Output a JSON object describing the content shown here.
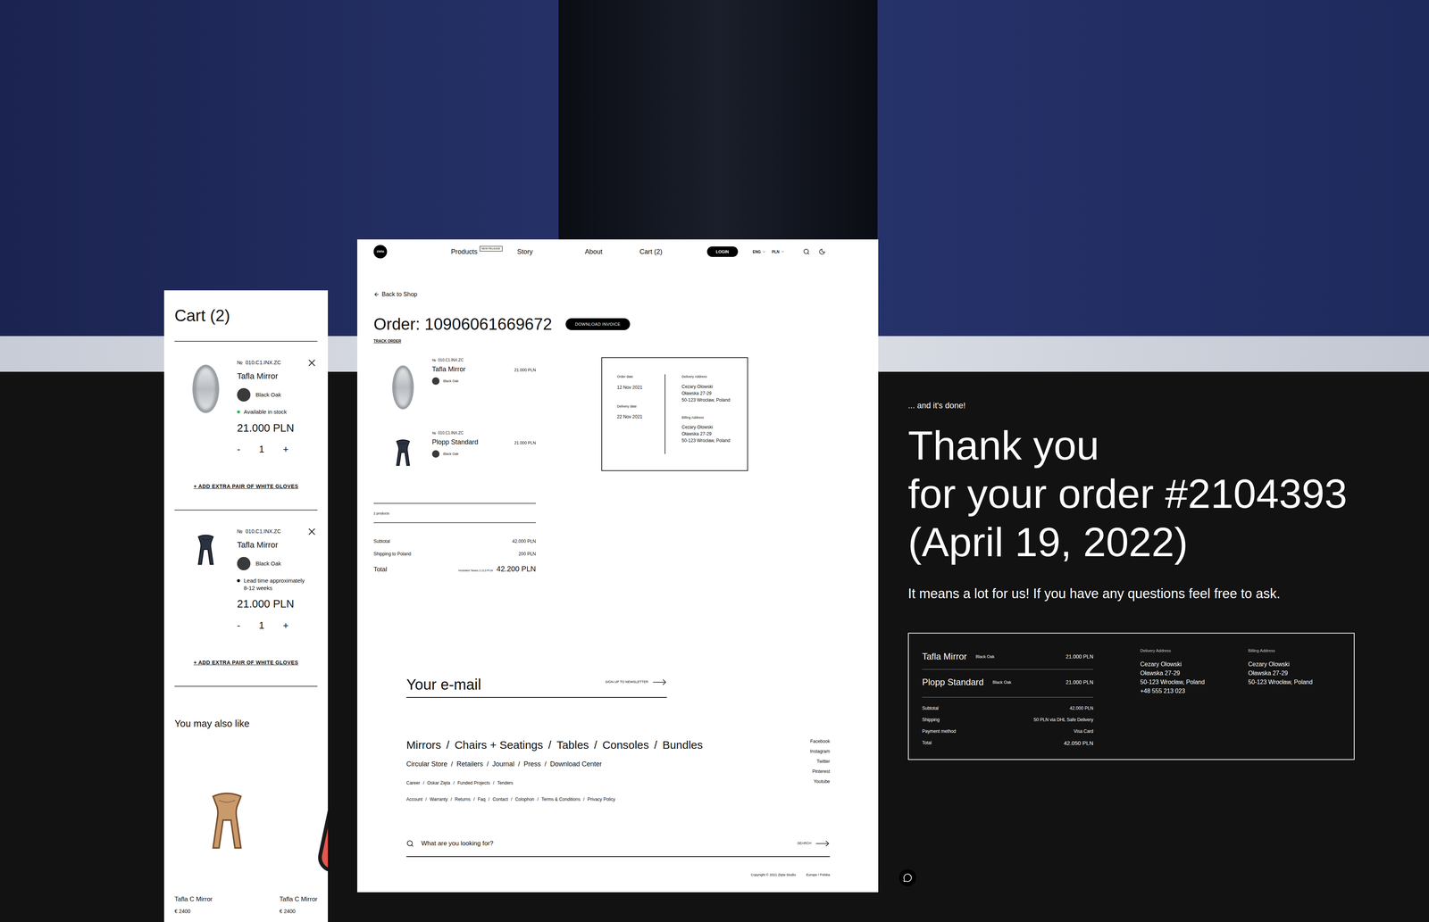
{
  "cart": {
    "title": "Cart (2)",
    "items": [
      {
        "kind": "mirror",
        "number_mark": "№",
        "sku": "010.C1.INX.ZC",
        "name": "Tafla Mirror",
        "finish": "Black Oak",
        "availability": "Available in stock",
        "color": "#2fb45a",
        "price": "21.000 PLN",
        "minus": "-",
        "quantity": "1",
        "plus": "+",
        "gloves": "+ ADD EXTRA PAIR OF WHITE GLOVES"
      },
      {
        "kind": "stool",
        "number_mark": "№",
        "sku": "010.C1.INX.ZC",
        "name": "Tafla Mirror",
        "finish": "Black Oak",
        "availability": "Lead time approximately 8-12 weeks",
        "color": "#111111",
        "price": "21.000 PLN",
        "minus": "-",
        "quantity": "1",
        "plus": "+",
        "gloves": "+ ADD EXTRA PAIR OF WHITE GLOVES"
      }
    ],
    "recommendations": {
      "title": "You may also like",
      "products": [
        {
          "kind": "stool",
          "name": "Tafla C Mirror",
          "price": "€ 2400"
        },
        {
          "kind": "mirror",
          "name": "Tafla C Mirror",
          "price": "€ 2400"
        }
      ]
    }
  },
  "page": {
    "nav": {
      "logo": "zieta",
      "items": [
        {
          "label": "Products",
          "badge": "NEW RELEASE"
        },
        {
          "label": "Story",
          "badge": ""
        },
        {
          "label": "About",
          "badge": ""
        },
        {
          "label": "Cart (2)",
          "badge": ""
        }
      ],
      "login": "LOGIN",
      "language": "ENG",
      "currency": "PLN"
    },
    "back": "Back to Shop",
    "order_title": "Order: 10906061669672",
    "download": "DOWNLOAD INVOICE",
    "track": "TRACK ORDER",
    "items": [
      {
        "kind": "mirror",
        "number_mark": "№",
        "sku": "010.C1.INX.ZC",
        "name": "Tafla Mirror",
        "finish": "Black Oak",
        "price": "21.000 PLN"
      },
      {
        "kind": "stool",
        "number_mark": "№",
        "sku": "010.C1.INX.ZC",
        "name": "Plopp Standard",
        "finish": "Black Oak",
        "price": "21.000 PLN"
      }
    ],
    "count": "2 products",
    "summary": [
      {
        "label": "Subtotal",
        "value": "42.000 PLN"
      },
      {
        "label": "Shipping to Poland",
        "value": "200 PLN"
      }
    ],
    "total": {
      "label": "Total",
      "note": "Included Taxes 2.113 PLN",
      "value": "42.200 PLN"
    },
    "details": {
      "dates": [
        {
          "label": "Order date",
          "value": "12 Nov 2021"
        },
        {
          "label": "Delivery date",
          "value": "22 Nov 2021"
        }
      ],
      "addresses": [
        {
          "label": "Delivery Address",
          "lines": [
            "Cezary Olowski",
            "Oławska 27-29",
            "50-123 Wrocław, Poland"
          ]
        },
        {
          "label": "Billing Address",
          "lines": [
            "Cezary Olowski",
            "Oławska 27-29",
            "50-123 Wrocław, Poland"
          ]
        }
      ]
    },
    "footer": {
      "email": "Your e-mail",
      "signup": "SIGN UP TO NEWSLETTER",
      "separator": "/",
      "categories": [
        "Mirrors",
        "Chairs + Seatings",
        "Tables",
        "Consoles",
        "Bundles"
      ],
      "secondary": [
        "Circular Store",
        "Retailers",
        "Journal",
        "Press",
        "Download Center"
      ],
      "tertiary": [
        "Career",
        "Oskar Zięta",
        "Funded Projects",
        "Tenders"
      ],
      "links": [
        "Account",
        "Warranty",
        "Returns",
        "Faq",
        "Contact",
        "Colophon",
        "Terms & Conditions",
        "Privacy Policy"
      ],
      "socials": [
        "Facebook",
        "Instagram",
        "Twitter",
        "Pinterest",
        "Youtube"
      ],
      "search_placeholder": "What are you looking for?",
      "search_button": "SEARCH",
      "copyright": "Copyright © 2021 Zięta Studio",
      "region": "Europe / Polska"
    }
  },
  "thanks": {
    "kicker": "... and it's done!",
    "heading": [
      "Thank you",
      "for your order #2104393",
      "(April 19, 2022)"
    ],
    "message": "It means a lot for us! If you have any questions feel free to ask.",
    "items": [
      {
        "name": "Tafla Mirror",
        "finish": "Black Oak",
        "price": "21.000 PLN"
      },
      {
        "name": "Plopp Standard",
        "finish": "Black Oak",
        "price": "21.000 PLN"
      }
    ],
    "summary": [
      {
        "label": "Subtotal",
        "value": "42.000 PLN"
      },
      {
        "label": "Shipping",
        "value": "50 PLN via DHL Safe Delivery"
      },
      {
        "label": "Payment method",
        "value": "Visa Card"
      },
      {
        "label": "Total",
        "value": "42.050 PLN"
      }
    ],
    "addresses": [
      {
        "label": "Delivery Address",
        "lines": [
          "Cezary Olowski",
          "Oławska 27-29",
          "50-123 Wrocław, Poland",
          "+48 555 213 023"
        ]
      },
      {
        "label": "Billing Address",
        "lines": [
          "Cezary Olowski",
          "Oławska 27-29",
          "50-123 Wrocław, Poland"
        ]
      }
    ]
  }
}
